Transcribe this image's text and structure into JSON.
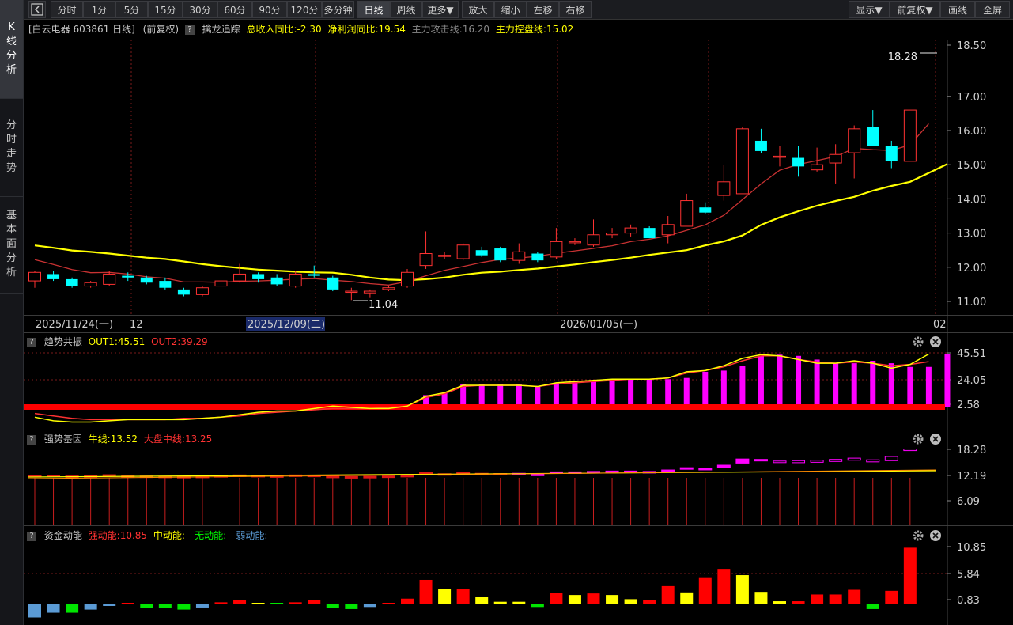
{
  "sidebar": {
    "tabs": [
      "K线分析",
      "分时走势",
      "基本面分析"
    ]
  },
  "toolbar": {
    "left_items": [
      "分时",
      "1分",
      "5分",
      "15分",
      "30分",
      "60分",
      "90分",
      "120分",
      "多分钟",
      "日线",
      "周线",
      "更多▼",
      "放大",
      "缩小",
      "左移",
      "右移"
    ],
    "right_items": [
      "显示▼",
      "前复权▼",
      "画线",
      "全屏"
    ],
    "active": "日线"
  },
  "info": {
    "stock": "[白云电器 603861 日线]",
    "adjust": "(前复权)",
    "indicator": "擒龙追踪",
    "rev": "总收入同比:-2.30",
    "profit": "净利润同比:19.54",
    "attack": "主力攻击线:16.20",
    "control": "主力控盘线:15.02"
  },
  "main_axis": [
    "18.50",
    "17.00",
    "16.00",
    "15.00",
    "14.00",
    "13.00",
    "12.00",
    "11.00"
  ],
  "max_label": "18.28",
  "min_label": "11.04",
  "date_axis": [
    "2025/11/24(一)",
    "12",
    "2025/12/09(二)",
    "2026/01/05(一)",
    "02"
  ],
  "panel1": {
    "name": "趋势共振",
    "out1": "OUT1:45.51",
    "out2": "OUT2:39.29",
    "axis": [
      "45.51",
      "24.05",
      "2.58"
    ]
  },
  "panel2": {
    "name": "强势基因",
    "bull": "牛线:13.52",
    "market": "大盘中线:13.25",
    "axis": [
      "18.28",
      "12.19",
      "6.09"
    ]
  },
  "panel3": {
    "name": "资金动能",
    "strong": "强动能:10.85",
    "mid": "中动能:-",
    "none": "无动能:-",
    "weak": "弱动能:-",
    "axis": [
      "10.85",
      "5.84",
      "0.83"
    ]
  },
  "colors": {
    "up": "#ff3232",
    "down": "#00ffff",
    "ma_yellow": "#ffff00",
    "magenta": "#ff00ff",
    "grid": "#7a1a1a"
  },
  "chart_data": [
    {
      "type": "candlestick",
      "title": "白云电器 603861 日线",
      "ylim": [
        11.0,
        18.5
      ],
      "ohlc": [
        [
          11.6,
          11.9,
          11.4,
          11.85
        ],
        [
          11.8,
          11.9,
          11.6,
          11.65
        ],
        [
          11.65,
          11.7,
          11.4,
          11.45
        ],
        [
          11.45,
          11.6,
          11.4,
          11.55
        ],
        [
          11.5,
          11.9,
          11.45,
          11.8
        ],
        [
          11.75,
          11.85,
          11.6,
          11.7
        ],
        [
          11.7,
          11.75,
          11.5,
          11.55
        ],
        [
          11.6,
          11.7,
          11.35,
          11.4
        ],
        [
          11.35,
          11.4,
          11.15,
          11.2
        ],
        [
          11.2,
          11.45,
          11.15,
          11.4
        ],
        [
          11.45,
          11.7,
          11.4,
          11.6
        ],
        [
          11.6,
          12.1,
          11.55,
          11.8
        ],
        [
          11.8,
          11.85,
          11.55,
          11.65
        ],
        [
          11.7,
          11.8,
          11.45,
          11.5
        ],
        [
          11.45,
          11.9,
          11.4,
          11.8
        ],
        [
          11.8,
          12.05,
          11.7,
          11.75
        ],
        [
          11.7,
          11.75,
          11.3,
          11.35
        ],
        [
          11.3,
          11.4,
          11.04,
          11.3
        ],
        [
          11.25,
          11.35,
          11.1,
          11.3
        ],
        [
          11.35,
          11.45,
          11.3,
          11.4
        ],
        [
          11.45,
          11.95,
          11.4,
          11.85
        ],
        [
          12.05,
          13.05,
          11.95,
          12.4
        ],
        [
          12.35,
          12.45,
          12.25,
          12.35
        ],
        [
          12.25,
          12.7,
          12.2,
          12.65
        ],
        [
          12.5,
          12.6,
          12.3,
          12.35
        ],
        [
          12.55,
          12.6,
          12.15,
          12.2
        ],
        [
          12.2,
          12.7,
          12.1,
          12.45
        ],
        [
          12.4,
          12.45,
          12.15,
          12.2
        ],
        [
          12.3,
          13.15,
          12.25,
          12.75
        ],
        [
          12.75,
          12.85,
          12.65,
          12.75
        ],
        [
          12.65,
          13.4,
          12.6,
          12.95
        ],
        [
          12.95,
          13.15,
          12.85,
          13.0
        ],
        [
          13.0,
          13.25,
          12.9,
          13.15
        ],
        [
          13.15,
          13.2,
          12.85,
          12.85
        ],
        [
          12.95,
          13.5,
          12.7,
          13.25
        ],
        [
          13.2,
          14.15,
          13.2,
          13.95
        ],
        [
          13.75,
          13.9,
          13.55,
          13.6
        ],
        [
          14.1,
          15.0,
          13.95,
          14.5
        ],
        [
          14.15,
          16.1,
          14.15,
          16.05
        ],
        [
          15.7,
          16.05,
          15.35,
          15.4
        ],
        [
          15.25,
          15.55,
          14.95,
          15.25
        ],
        [
          15.2,
          15.55,
          14.65,
          14.95
        ],
        [
          14.85,
          15.5,
          14.8,
          15.0
        ],
        [
          15.05,
          15.6,
          14.45,
          15.3
        ],
        [
          15.35,
          16.15,
          14.6,
          16.05
        ],
        [
          16.1,
          16.6,
          15.55,
          15.55
        ],
        [
          15.55,
          15.7,
          14.9,
          15.1
        ],
        [
          15.1,
          16.6,
          15.1,
          16.6
        ]
      ],
      "ma_attack": [
        12.22,
        12.08,
        11.93,
        11.84,
        11.85,
        11.8,
        11.72,
        11.68,
        11.57,
        11.57,
        11.56,
        11.59,
        11.6,
        11.62,
        11.65,
        11.67,
        11.62,
        11.58,
        11.52,
        11.48,
        11.58,
        11.75,
        11.91,
        12.02,
        12.14,
        12.23,
        12.27,
        12.32,
        12.41,
        12.48,
        12.55,
        12.63,
        12.75,
        12.82,
        12.92,
        13.08,
        13.24,
        13.52,
        13.98,
        14.44,
        14.84,
        15.01,
        15.12,
        15.24,
        15.48,
        15.44,
        15.42,
        15.58,
        16.2
      ],
      "ma_control": [
        12.64,
        12.57,
        12.49,
        12.45,
        12.4,
        12.34,
        12.28,
        12.24,
        12.17,
        12.09,
        12.03,
        11.98,
        11.93,
        11.9,
        11.87,
        11.85,
        11.84,
        11.78,
        11.7,
        11.64,
        11.62,
        11.65,
        11.7,
        11.78,
        11.84,
        11.87,
        11.92,
        11.96,
        12.02,
        12.08,
        12.15,
        12.21,
        12.28,
        12.36,
        12.43,
        12.5,
        12.64,
        12.76,
        12.93,
        13.24,
        13.46,
        13.64,
        13.8,
        13.94,
        14.06,
        14.24,
        14.38,
        14.5,
        14.76,
        15.02
      ]
    },
    {
      "type": "bar",
      "title": "趋势共振",
      "ylim": [
        0,
        50
      ],
      "bars": [
        0,
        0,
        0,
        0,
        0,
        0,
        0,
        0,
        0,
        0,
        0,
        0,
        0,
        0,
        0,
        0,
        0,
        0,
        0,
        0,
        0,
        12,
        14,
        21,
        21,
        21,
        21,
        19,
        22,
        23,
        24,
        25,
        25,
        25,
        25,
        26,
        31,
        32,
        36,
        44,
        45,
        44,
        41,
        38,
        38,
        40,
        38,
        35,
        35,
        45.51
      ],
      "out1": [
        -6,
        -9,
        -10,
        -10,
        -9,
        -8,
        -8,
        -8,
        -8,
        -7,
        -6,
        -4,
        -2,
        -1,
        -1,
        1,
        3,
        2,
        1,
        1,
        3,
        11,
        14,
        20,
        20,
        20,
        20,
        19,
        22,
        23,
        24,
        25,
        25,
        25,
        26,
        31,
        32,
        36,
        42,
        45,
        44,
        41,
        38,
        38,
        40,
        38,
        34,
        37,
        45.51
      ],
      "out2": [
        -3,
        -5,
        -7,
        -8,
        -8,
        -8,
        -8,
        -8,
        -7,
        -7,
        -6,
        -5,
        -3,
        -2,
        -1,
        0,
        1,
        1,
        1,
        2,
        3,
        10,
        13,
        19,
        20,
        20,
        20,
        19,
        21,
        22,
        23,
        24,
        25,
        25,
        26,
        30,
        32,
        35,
        40,
        44,
        44,
        41,
        39,
        38,
        39,
        38,
        36,
        37,
        39.29
      ]
    },
    {
      "type": "bar",
      "title": "强势基因",
      "ylim": [
        0,
        18.28
      ],
      "blocks": [
        [
          11.8,
          12.0
        ],
        [
          11.9,
          12.1
        ],
        [
          11.7,
          11.9
        ],
        [
          11.8,
          11.95
        ],
        [
          12.0,
          12.2
        ],
        [
          11.85,
          12.0
        ],
        [
          11.75,
          11.9
        ],
        [
          11.7,
          11.85
        ],
        [
          11.65,
          11.8
        ],
        [
          11.7,
          11.85
        ],
        [
          11.8,
          12.0
        ],
        [
          11.95,
          12.15
        ],
        [
          11.9,
          12.05
        ],
        [
          11.8,
          11.95
        ],
        [
          11.95,
          12.15
        ],
        [
          11.95,
          12.1
        ],
        [
          11.7,
          11.85
        ],
        [
          11.6,
          11.75
        ],
        [
          11.65,
          11.8
        ],
        [
          11.75,
          11.9
        ],
        [
          11.9,
          12.05
        ],
        [
          12.4,
          12.7
        ],
        [
          12.25,
          12.45
        ],
        [
          12.5,
          12.75
        ],
        [
          12.35,
          12.55
        ],
        [
          12.3,
          12.5
        ],
        [
          12.35,
          12.55
        ],
        [
          12.2,
          12.35
        ],
        [
          12.7,
          12.9
        ],
        [
          12.7,
          12.9
        ],
        [
          12.8,
          13.0
        ],
        [
          12.9,
          13.1
        ],
        [
          12.9,
          13.1
        ],
        [
          12.8,
          13.0
        ],
        [
          13.1,
          13.35
        ],
        [
          13.6,
          13.9
        ],
        [
          13.5,
          13.75
        ],
        [
          14.0,
          14.5
        ],
        [
          15.0,
          16.0
        ],
        [
          15.6,
          15.9
        ],
        [
          15.2,
          15.5
        ],
        [
          15.1,
          15.6
        ],
        [
          15.2,
          15.7
        ],
        [
          15.4,
          15.9
        ],
        [
          15.7,
          16.2
        ],
        [
          15.3,
          15.8
        ],
        [
          15.6,
          16.6
        ],
        [
          18.28,
          18.4
        ]
      ],
      "bull": 13.52,
      "market": 13.25
    },
    {
      "type": "bar",
      "title": "资金动能",
      "ylim": [
        -2.5,
        10.85
      ],
      "values": [
        -2.5,
        -1.6,
        -1.6,
        -1.0,
        -0.2,
        0.3,
        -0.7,
        -0.7,
        -1.0,
        -0.6,
        0.4,
        0.9,
        0.3,
        0.2,
        0.4,
        0.8,
        -0.7,
        -0.9,
        -0.5,
        0.3,
        1.1,
        4.7,
        2.9,
        3.0,
        1.4,
        0.5,
        0.5,
        -0.5,
        2.2,
        1.8,
        2.1,
        1.8,
        1.0,
        0.9,
        3.5,
        2.3,
        5.2,
        6.8,
        5.6,
        2.4,
        0.6,
        0.6,
        1.9,
        1.9,
        2.8,
        -0.9,
        2.6,
        10.85
      ],
      "colors": [
        "b",
        "b",
        "g",
        "b",
        "b",
        "r",
        "g",
        "g",
        "g",
        "b",
        "r",
        "r",
        "y",
        "g",
        "r",
        "r",
        "g",
        "g",
        "b",
        "r",
        "r",
        "r",
        "y",
        "r",
        "y",
        "y",
        "y",
        "g",
        "r",
        "y",
        "r",
        "y",
        "y",
        "r",
        "r",
        "y",
        "r",
        "r",
        "y",
        "y",
        "y",
        "r",
        "r",
        "r",
        "r",
        "g",
        "r",
        "r"
      ]
    }
  ]
}
